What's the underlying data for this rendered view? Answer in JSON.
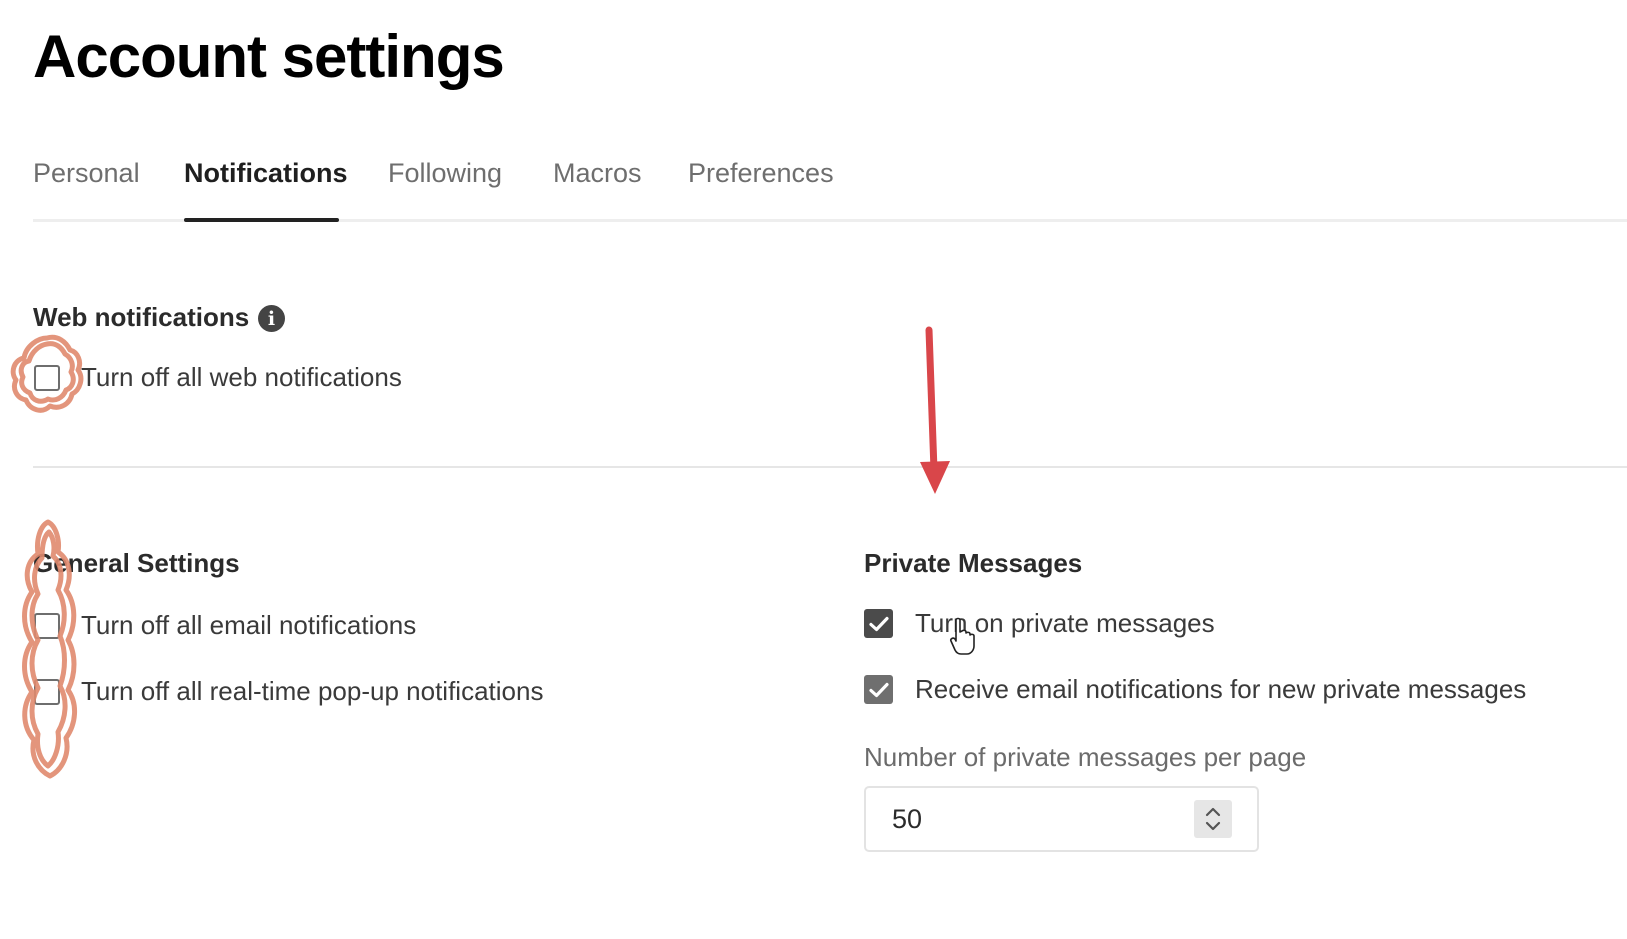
{
  "page": {
    "title": "Account settings"
  },
  "tabs": [
    {
      "label": "Personal",
      "active": false
    },
    {
      "label": "Notifications",
      "active": true
    },
    {
      "label": "Following",
      "active": false
    },
    {
      "label": "Macros",
      "active": false
    },
    {
      "label": "Preferences",
      "active": false
    }
  ],
  "web_notifications": {
    "heading": "Web notifications",
    "info_icon": "info-icon",
    "options": [
      {
        "label": "Turn off all web notifications",
        "checked": false
      }
    ]
  },
  "general_settings": {
    "heading": "General Settings",
    "options": [
      {
        "label": "Turn off all email notifications",
        "checked": false
      },
      {
        "label": "Turn off all real-time pop-up notifications",
        "checked": false
      }
    ]
  },
  "private_messages": {
    "heading": "Private Messages",
    "options": [
      {
        "label": "Turn on private messages",
        "checked": true
      },
      {
        "label": "Receive email notifications for new private messages",
        "checked": true
      }
    ],
    "per_page_label": "Number of private messages per page",
    "per_page_value": "50"
  },
  "annotations": {
    "arrow_color": "#d9464a",
    "highlight_color": "#e08a6e"
  },
  "cursor": "hand-pointer-icon"
}
